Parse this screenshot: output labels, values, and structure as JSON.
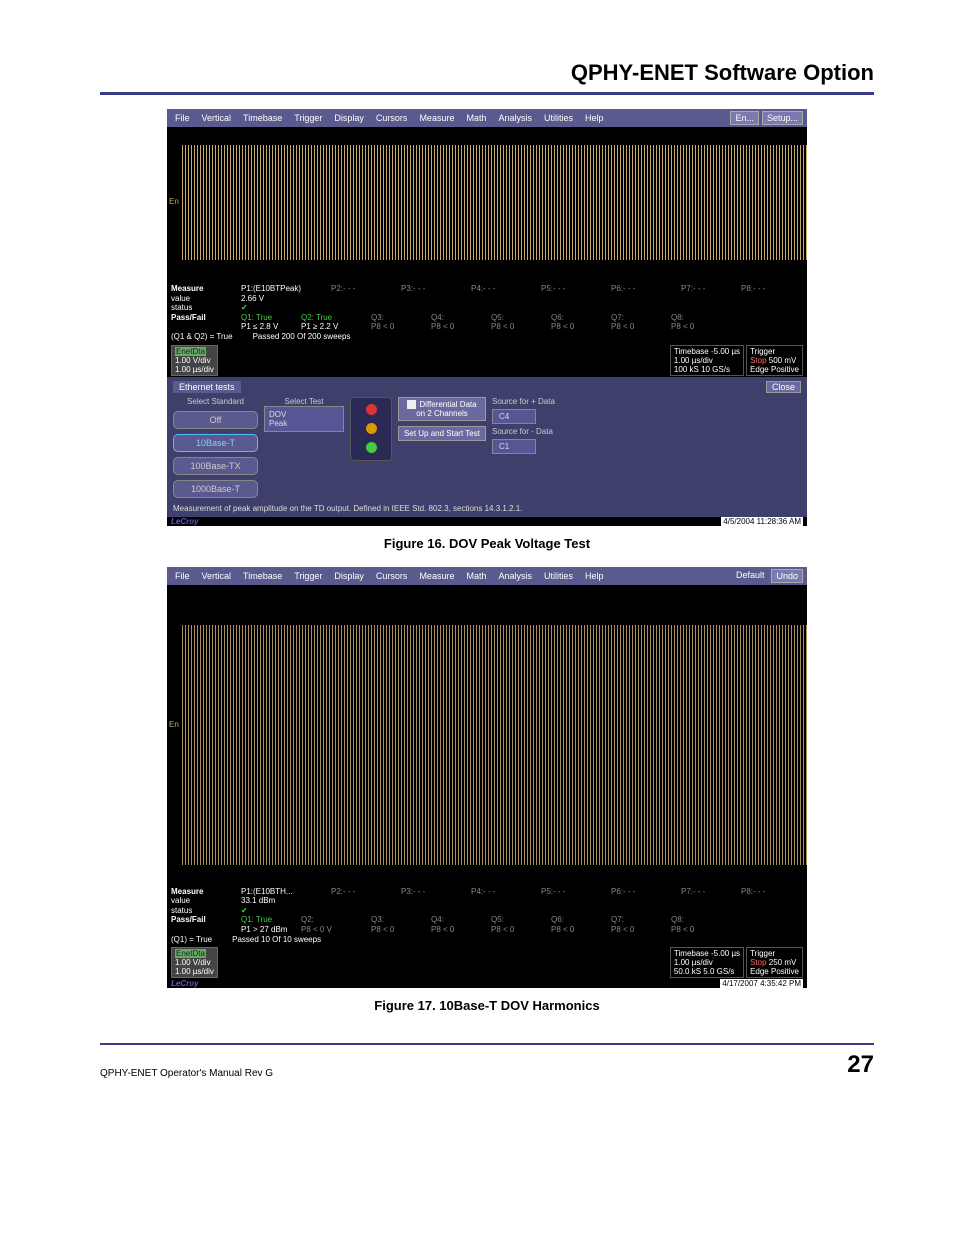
{
  "doc": {
    "headerTitle": "QPHY-ENET Software Option",
    "footerLeft": "QPHY-ENET Operator's Manual Rev G",
    "pageNum": "27"
  },
  "captions": {
    "fig16": "Figure 16. DOV Peak Voltage Test",
    "fig17": "Figure 17. 10Base-T DOV Harmonics"
  },
  "menu": {
    "items": [
      "File",
      "Vertical",
      "Timebase",
      "Trigger",
      "Display",
      "Cursors",
      "Measure",
      "Math",
      "Analysis",
      "Utilities",
      "Help"
    ],
    "right1a": "En...",
    "right1b": "Setup...",
    "right2a": "Default",
    "right2b": "Undo"
  },
  "scope1": {
    "measure": {
      "p1name": "P1:(E10BTPeak)",
      "p1val": "2.66 V",
      "labels": [
        "P2:- - -",
        "P3:- - -",
        "P4:- - -",
        "P5:- - -",
        "P6:- - -",
        "P7:- - -",
        "P8:- - -"
      ]
    },
    "pf": {
      "q1": "Q1: True",
      "q1cond": "P1 ≤ 2.8 V",
      "q2": "Q2: True",
      "q2cond": "P1 ≥ 2.2 V",
      "q3": "Q3:",
      "q4": "Q4:",
      "q5": "Q5:",
      "q6": "Q6:",
      "q7": "Q7:",
      "q8": "Q8:",
      "pcond": "P8 < 0",
      "summary": "(Q1 & Q2) =    True",
      "passed": "Passed    200   Of    200  sweeps"
    },
    "chan": {
      "name": "EnetDta",
      "l1": "1.00 V/div",
      "l2": "1.00 µs/div"
    },
    "tb": {
      "title": "Timebase",
      "r1": "-5.00 µs",
      "r2": "1.00 µs/div",
      "r3": "100 kS",
      "r4": "10 GS/s"
    },
    "trig": {
      "title": "Trigger",
      "r1": "Stop",
      "r2": "500 mV",
      "r3": "Edge",
      "r4": "Positive"
    },
    "panel": {
      "tab": "Ethernet tests",
      "close": "Close",
      "stdTitle": "Select Standard",
      "btnOff": "Off",
      "btn10": "10Base-T",
      "btn100": "100Base-TX",
      "btn1000": "1000Base-T",
      "testTitle": "Select Test",
      "testL1": "DOV",
      "testL2": "Peak",
      "actDiff": "Differential Data on 2 Channels",
      "actSetup": "Set Up and Start Test",
      "srcPlus": "Source for + Data",
      "srcPlusV": "C4",
      "srcMinus": "Source for - Data",
      "srcMinusV": "C1",
      "desc": "Measurement of peak amplitude on the TD output. Defined in IEEE Std. 802.3, sections 14.3.1.2.1."
    },
    "ts": "4/5/2004 11:28:36 AM"
  },
  "scope2": {
    "measure": {
      "p1name": "P1:(E10BTH...",
      "p1val": "33.1 dBm",
      "labels": [
        "P2:- - -",
        "P3:- - -",
        "P4:- - -",
        "P5:- - -",
        "P6:- - -",
        "P7:- - -",
        "P8:- - -"
      ]
    },
    "pf": {
      "q1": "Q1: True",
      "q1cond": "P1 > 27 dBm",
      "q2": "Q2:",
      "q2cond": "P8 < 0 V",
      "q3": "Q3:",
      "q4": "Q4:",
      "q5": "Q5:",
      "q6": "Q6:",
      "q7": "Q7:",
      "q8": "Q8:",
      "pcond": "P8 < 0",
      "summary": "(Q1) =   True",
      "passed": "Passed  10  Of  10   sweeps"
    },
    "chan": {
      "name": "EnetDta",
      "l1": "1.00 V/div",
      "l2": "1.00 µs/div"
    },
    "tb": {
      "title": "Timebase",
      "r1": "-5.00 µs",
      "r2": "1.00 µs/div",
      "r3": "50.0 kS",
      "r4": "5.0 GS/s"
    },
    "trig": {
      "title": "Trigger",
      "r1": "Stop",
      "r2": "250 mV",
      "r3": "Edge",
      "r4": "Positive"
    },
    "ts": "4/17/2007 4:35:42 PM"
  },
  "common": {
    "measLabel": "Measure",
    "valLabel": "value",
    "statLabel": "status",
    "pfLabel": "Pass/Fail",
    "brand": "LeCroy",
    "check": "✔",
    "en": "En"
  }
}
